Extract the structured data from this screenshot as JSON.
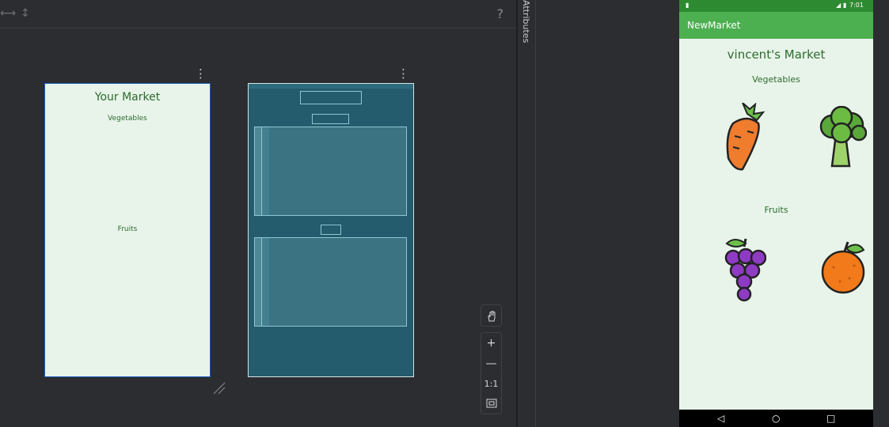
{
  "editor": {
    "help_label": "?",
    "design_menu_glyph": "⋮",
    "blueprint_menu_glyph": "⋮",
    "toolbar_icons": [
      "horizontal-arrows-icon",
      "vertical-arrows-icon"
    ]
  },
  "design_preview": {
    "title": "Your Market",
    "vegetables_label": "Vegetables",
    "fruits_label": "Fruits"
  },
  "zoom_controls": {
    "pan_icon": "hand-icon",
    "zoom_in_label": "+",
    "zoom_out_label": "—",
    "actual_size_label": "1:1",
    "fit_icon": "fit-screen-icon"
  },
  "attributes_panel": {
    "label": "Attributes"
  },
  "emulator": {
    "status_time": "7:01",
    "app_title": "NewMarket",
    "market_title": "vincent's Market",
    "vegetables_label": "Vegetables",
    "fruits_label": "Fruits",
    "images": [
      "carrot",
      "broccoli",
      "grapes",
      "orange"
    ]
  },
  "colors": {
    "accent_green": "#4caf50",
    "status_green": "#2e8a30",
    "text_green": "#2e6b2f",
    "screen_background": "#e8f4ea",
    "blueprint_blue": "#245b6d"
  }
}
